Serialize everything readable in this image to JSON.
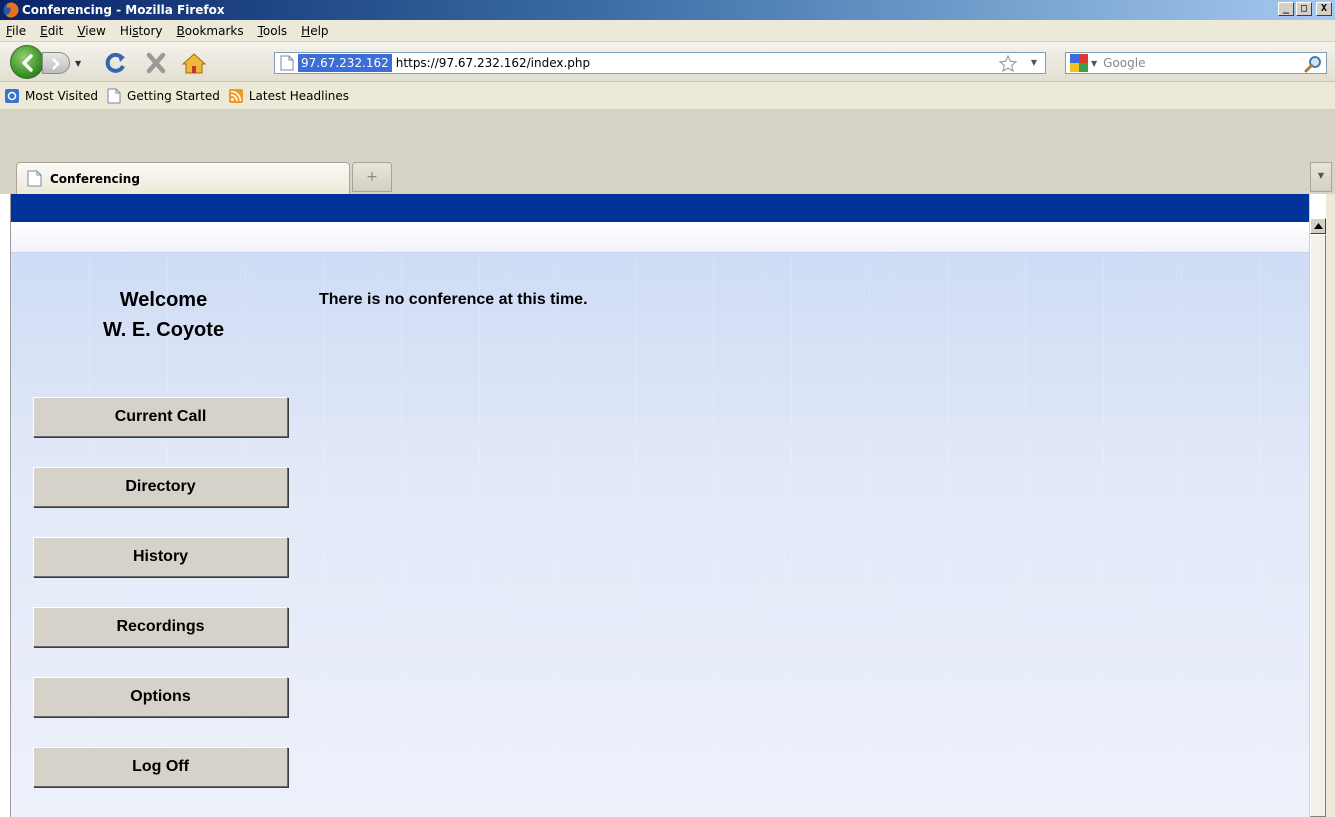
{
  "window": {
    "title": "Conferencing - Mozilla Firefox",
    "minimize": "_",
    "maximize": "□",
    "close": "X"
  },
  "menu": {
    "items": [
      {
        "label_pre": "",
        "label_key": "F",
        "label_post": "ile"
      },
      {
        "label_pre": "",
        "label_key": "E",
        "label_post": "dit"
      },
      {
        "label_pre": "",
        "label_key": "V",
        "label_post": "iew"
      },
      {
        "label_pre": "Hi",
        "label_key": "s",
        "label_post": "tory"
      },
      {
        "label_pre": "",
        "label_key": "B",
        "label_post": "ookmarks"
      },
      {
        "label_pre": "",
        "label_key": "T",
        "label_post": "ools"
      },
      {
        "label_pre": "",
        "label_key": "H",
        "label_post": "elp"
      }
    ]
  },
  "navigation": {
    "site_identity": "97.67.232.162",
    "url": "https://97.67.232.162/index.php",
    "search_placeholder": "Google"
  },
  "bookmarks": {
    "items": [
      {
        "label": "Most Visited",
        "icon": "most-visited-icon"
      },
      {
        "label": "Getting Started",
        "icon": "page-icon"
      },
      {
        "label": "Latest Headlines",
        "icon": "rss-icon"
      }
    ]
  },
  "tabs": {
    "active_label": "Conferencing",
    "new_tab_symbol": "+"
  },
  "page": {
    "welcome_line1": "Welcome",
    "welcome_line2": "W. E. Coyote",
    "status_message": "There is no conference at this time.",
    "buttons": [
      {
        "label": "Current Call"
      },
      {
        "label": "Directory"
      },
      {
        "label": "History"
      },
      {
        "label": "Recordings"
      },
      {
        "label": "Options"
      },
      {
        "label": "Log Off"
      }
    ]
  },
  "colors": {
    "page_header": "#003399",
    "button_face": "#d6d2ca",
    "body_gradient_top": "#cfdcf5"
  }
}
